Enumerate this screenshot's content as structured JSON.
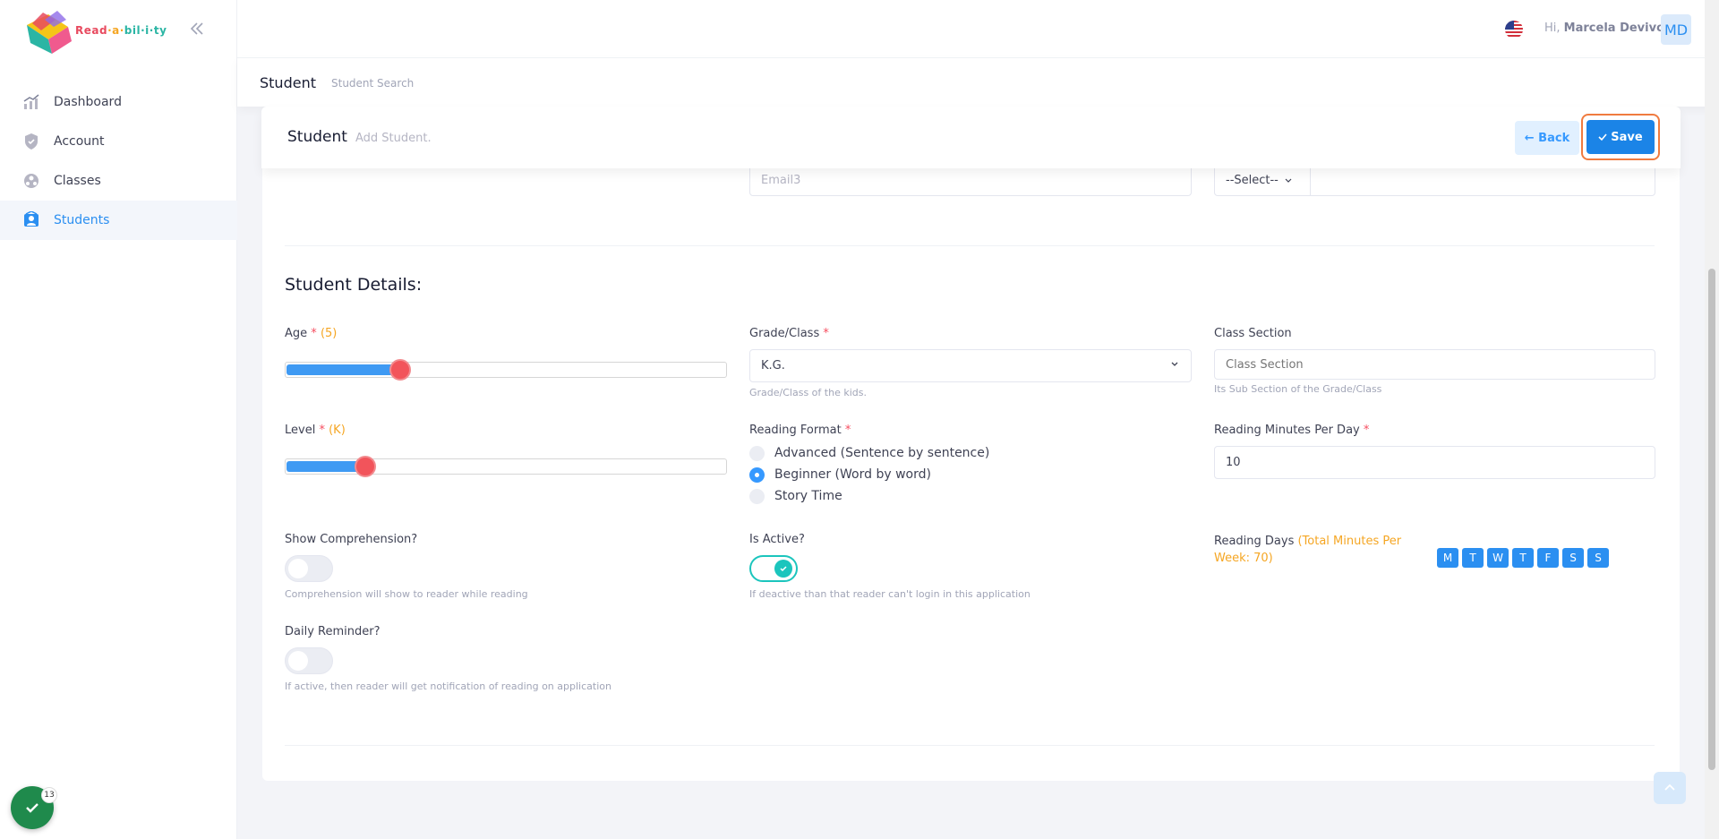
{
  "app": {
    "logo_text_parts": [
      "Read",
      "·a·",
      "bil·i·ty"
    ]
  },
  "sidebar": {
    "items": [
      {
        "label": "Dashboard",
        "icon": "chart-icon"
      },
      {
        "label": "Account",
        "icon": "shield-icon"
      },
      {
        "label": "Classes",
        "icon": "classes-icon"
      },
      {
        "label": "Students",
        "icon": "student-icon",
        "active": true
      }
    ],
    "notification_count": "13"
  },
  "topbar": {
    "greeting_prefix": "Hi,",
    "user_name": "Marcela Devivo",
    "avatar_initials": "MD"
  },
  "subheader": {
    "title": "Student",
    "subtitle": "Student Search"
  },
  "card": {
    "title": "Student",
    "subtitle": "Add Student.",
    "back_label": "← Back",
    "save_label": "Save"
  },
  "contact": {
    "email3_placeholder": "Email3",
    "phone_select": "--Select--"
  },
  "details": {
    "section_title": "Student Details:",
    "age": {
      "label": "Age",
      "required": "*",
      "value_text": "(5)",
      "value": 5,
      "fraction": 0.26
    },
    "grade": {
      "label": "Grade/Class",
      "required": "*",
      "value": "K.G.",
      "hint": "Grade/Class of the kids."
    },
    "class_section": {
      "label": "Class Section",
      "placeholder": "Class Section",
      "hint": "Its Sub Section of the Grade/Class"
    },
    "level": {
      "label": "Level",
      "required": "*",
      "value_text": "(K)",
      "fraction": 0.18
    },
    "reading_format": {
      "label": "Reading Format",
      "required": "*",
      "options": [
        "Advanced (Sentence by sentence)",
        "Beginner (Word by word)",
        "Story Time"
      ],
      "selected": "Beginner (Word by word)"
    },
    "reading_minutes": {
      "label": "Reading Minutes Per Day",
      "required": "*",
      "value": "10"
    },
    "show_comprehension": {
      "label": "Show Comprehension?",
      "enabled": false,
      "hint": "Comprehension will show to reader while reading"
    },
    "is_active": {
      "label": "Is Active?",
      "enabled": true,
      "hint": "If deactive than that reader can't login in this application"
    },
    "reading_days": {
      "label": "Reading Days",
      "total_line1": "(Total Minutes Per",
      "total_line2": "Week: 70)",
      "days": [
        "M",
        "T",
        "W",
        "T",
        "F",
        "S",
        "S"
      ]
    },
    "daily_reminder": {
      "label": "Daily Reminder?",
      "enabled": false,
      "hint": "If active, then reader will get notification of reading on application"
    }
  },
  "colors": {
    "primary": "#2b8ff1",
    "accent": "#f5a623",
    "success_toggle": "#1bc5bd",
    "slider_thumb": "#f2545b",
    "save_highlight": "#f07b3f"
  }
}
